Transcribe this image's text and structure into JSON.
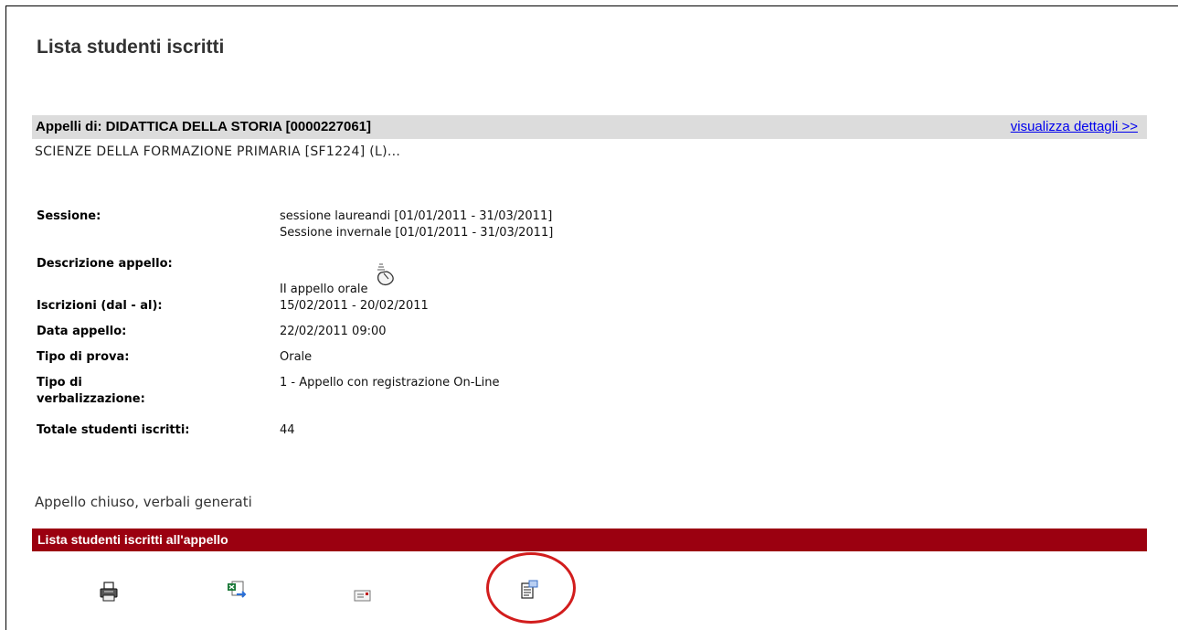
{
  "page_title": "Lista studenti iscritti",
  "course": {
    "title": "Appelli di: DIDATTICA DELLA STORIA [0000227061]",
    "details_link": "visualizza dettagli >>",
    "subtitle": "SCIENZE DELLA FORMAZIONE PRIMARIA [SF1224] (L)..."
  },
  "info": {
    "sessione_label": "Sessione:",
    "sessione_value_1": "sessione laureandi [01/01/2011 - 31/03/2011]",
    "sessione_value_2": "Sessione invernale [01/01/2011 - 31/03/2011]",
    "descrizione_label": "Descrizione appello:",
    "descrizione_value": "II appello orale",
    "iscrizioni_label": "Iscrizioni (dal - al):",
    "iscrizioni_value": "15/02/2011 - 20/02/2011",
    "data_label": "Data appello:",
    "data_value": "22/02/2011 09:00",
    "tipo_prova_label": "Tipo di prova:",
    "tipo_prova_value": "Orale",
    "tipo_verb_label_1": "Tipo di",
    "tipo_verb_label_2": "verbalizzazione:",
    "tipo_verb_value": "1 - Appello con registrazione On-Line",
    "totale_label": "Totale studenti iscritti:",
    "totale_value": "44"
  },
  "status": "Appello chiuso, verbali generati",
  "list_bar_title": "Lista studenti iscritti all'appello",
  "toolbar": {
    "icons": [
      "print-icon",
      "excel-export-icon",
      "email-icon",
      "document-icon"
    ]
  },
  "colors": {
    "list_bar": "#9b0010",
    "course_bar": "#dcdcdc",
    "link": "#0000ee",
    "highlight": "#d21d1d"
  }
}
